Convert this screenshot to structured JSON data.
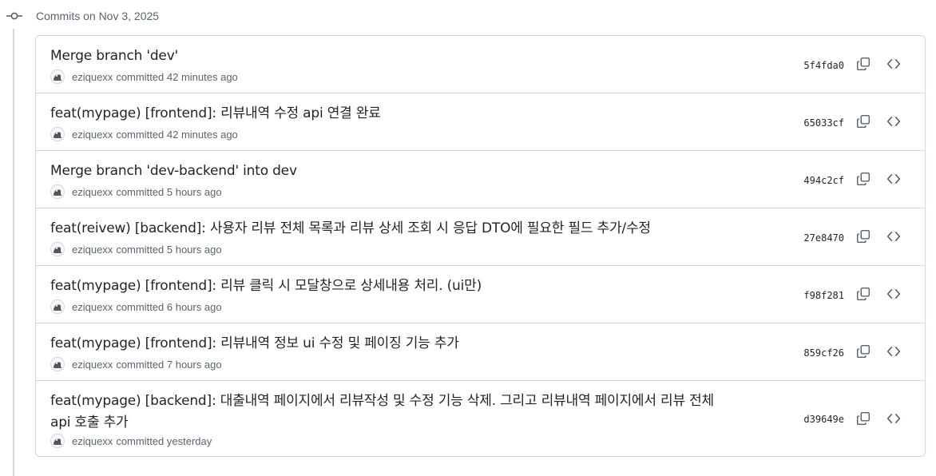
{
  "group": {
    "heading": "Commits on Nov 3, 2025",
    "node_icon": "git-commit-icon"
  },
  "commits": [
    {
      "title": "Merge branch 'dev'",
      "author": "eziquexx",
      "committed": "committed 42 minutes ago",
      "sha": "5f4fda0"
    },
    {
      "title": "feat(mypage) [frontend]: 리뷰내역 수정 api 연결 완료",
      "author": "eziquexx",
      "committed": "committed 42 minutes ago",
      "sha": "65033cf"
    },
    {
      "title": "Merge branch 'dev-backend' into dev",
      "author": "eziquexx",
      "committed": "committed 5 hours ago",
      "sha": "494c2cf"
    },
    {
      "title": "feat(reivew) [backend]: 사용자 리뷰 전체 목록과 리뷰 상세 조회 시 응답 DTO에 필요한 필드 추가/수정",
      "author": "eziquexx",
      "committed": "committed 5 hours ago",
      "sha": "27e8470"
    },
    {
      "title": "feat(mypage) [frontend]: 리뷰 클릭 시 모달창으로 상세내용 처리. (ui만)",
      "author": "eziquexx",
      "committed": "committed 6 hours ago",
      "sha": "f98f281"
    },
    {
      "title": "feat(mypage) [frontend]: 리뷰내역 정보 ui 수정 및 페이징 기능 추가",
      "author": "eziquexx",
      "committed": "committed 7 hours ago",
      "sha": "859cf26"
    },
    {
      "title": "feat(mypage) [backend]: 대출내역 페이지에서 리뷰작성 및 수정 기능 삭제. 그리고 리뷰내역 페이지에서 리뷰 전체 api 호출 추가",
      "author": "eziquexx",
      "committed": "committed yesterday",
      "sha": "d39649e"
    }
  ],
  "icons": {
    "copy": "copy-icon",
    "browse": "code-icon",
    "avatar": "avatar-image"
  },
  "colors": {
    "border": "#d1d9e0",
    "text": "#1f2328",
    "muted": "#59636e"
  }
}
